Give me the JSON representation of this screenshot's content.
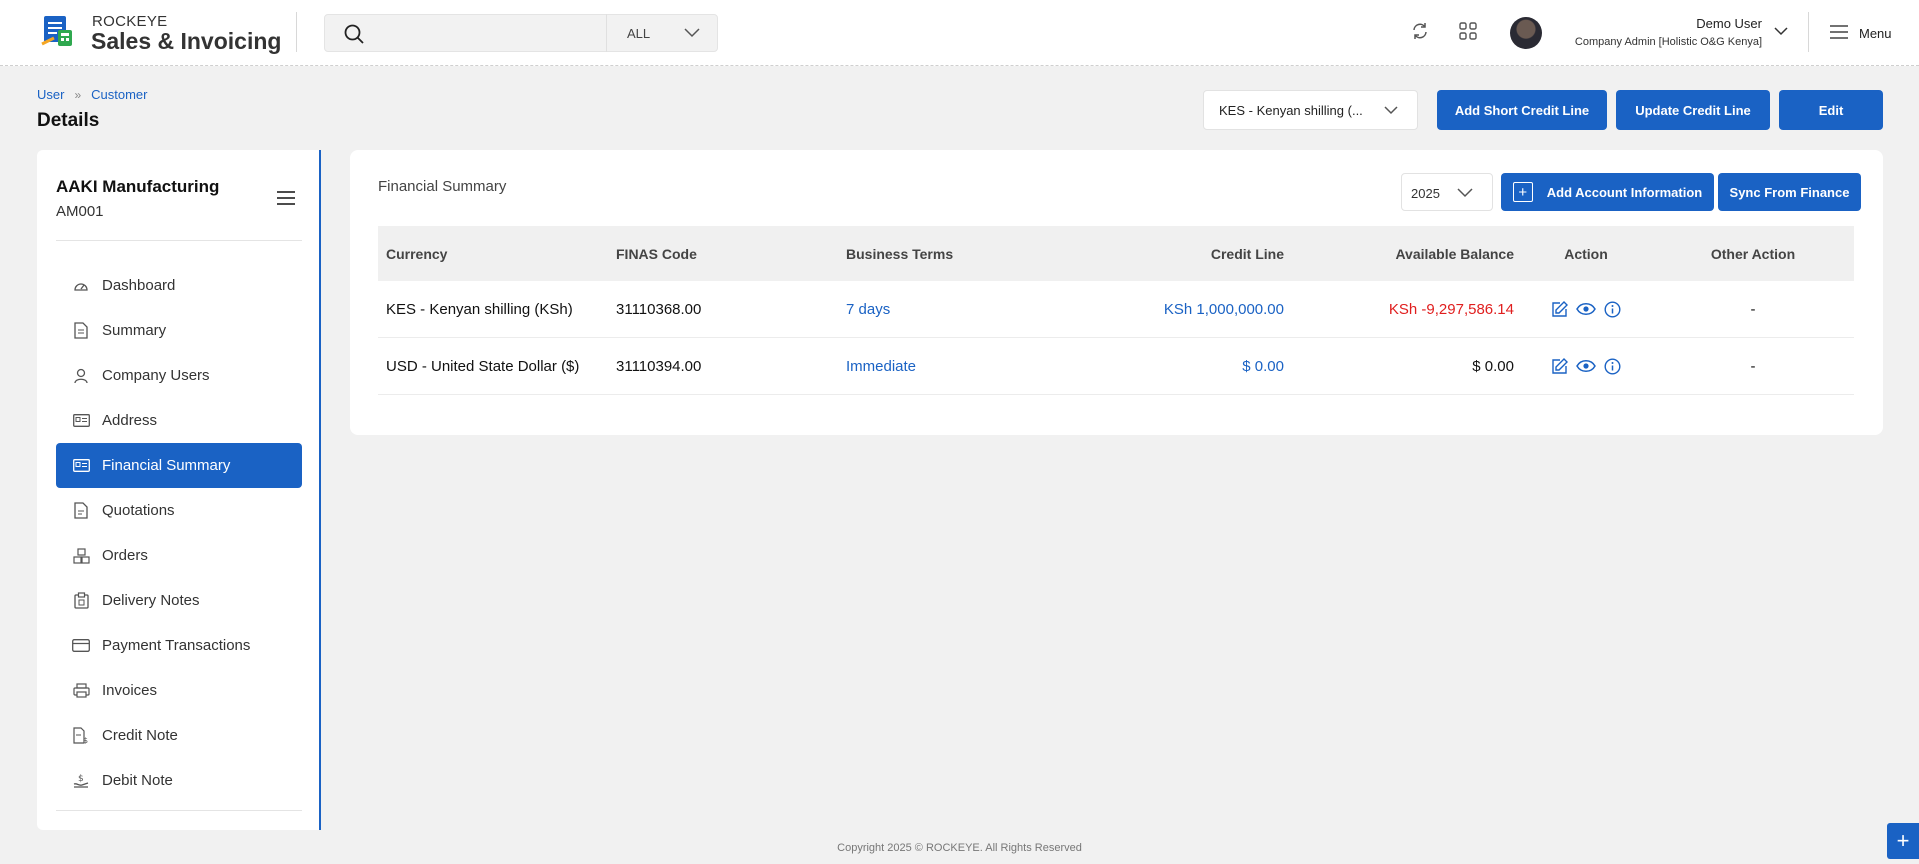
{
  "app": {
    "brand_top": "ROCKEYE",
    "brand_bottom": "Sales & Invoicing"
  },
  "search": {
    "value": "",
    "placeholder": "",
    "scope": "ALL"
  },
  "user": {
    "name": "Demo User",
    "role": "Company Admin [Holistic O&G Kenya]"
  },
  "header": {
    "menu_label": "Menu"
  },
  "breadcrumb": {
    "items": [
      "User",
      "Customer"
    ]
  },
  "page": {
    "title": "Details",
    "currency_selected": "KES - Kenyan shilling (...",
    "buttons": {
      "add_short_credit": "Add Short Credit Line",
      "update_credit": "Update Credit Line",
      "edit": "Edit"
    }
  },
  "customer": {
    "name": "AAKI Manufacturing",
    "code": "AM001"
  },
  "sidebar": {
    "items": [
      {
        "label": "Dashboard",
        "icon": "dashboard-icon"
      },
      {
        "label": "Summary",
        "icon": "document-icon"
      },
      {
        "label": "Company Users",
        "icon": "user-icon"
      },
      {
        "label": "Address",
        "icon": "address-card-icon"
      },
      {
        "label": "Financial Summary",
        "icon": "finance-card-icon"
      },
      {
        "label": "Quotations",
        "icon": "quotation-icon"
      },
      {
        "label": "Orders",
        "icon": "orders-icon"
      },
      {
        "label": "Delivery Notes",
        "icon": "clipboard-icon"
      },
      {
        "label": "Payment Transactions",
        "icon": "credit-card-icon"
      },
      {
        "label": "Invoices",
        "icon": "printer-icon"
      },
      {
        "label": "Credit Note",
        "icon": "credit-note-icon"
      },
      {
        "label": "Debit Note",
        "icon": "debit-note-icon"
      }
    ],
    "active": "Financial Summary"
  },
  "financial_summary": {
    "title": "Financial Summary",
    "year": "2025",
    "add_account_label": "Add Account Information",
    "sync_label": "Sync From Finance",
    "columns": [
      "Currency",
      "FINAS Code",
      "Business Terms",
      "Credit Line",
      "Available Balance",
      "Action",
      "Other Action"
    ],
    "rows": [
      {
        "currency": "KES - Kenyan shilling (KSh)",
        "finas_code": "31110368.00",
        "business_terms": "7 days",
        "credit_line": "KSh 1,000,000.00",
        "available_balance": "KSh -9,297,586.14",
        "other_action": "-"
      },
      {
        "currency": "USD - United State Dollar ($)",
        "finas_code": "31110394.00",
        "business_terms": "Immediate",
        "credit_line": "$ 0.00",
        "available_balance": "$ 0.00",
        "other_action": "-"
      }
    ]
  },
  "footer": {
    "copyright": "Copyright 2025 © ROCKEYE. All Rights Reserved"
  },
  "colors": {
    "primary": "#1a62c4",
    "negative": "#e01e1e",
    "background": "#f1f1f1"
  }
}
